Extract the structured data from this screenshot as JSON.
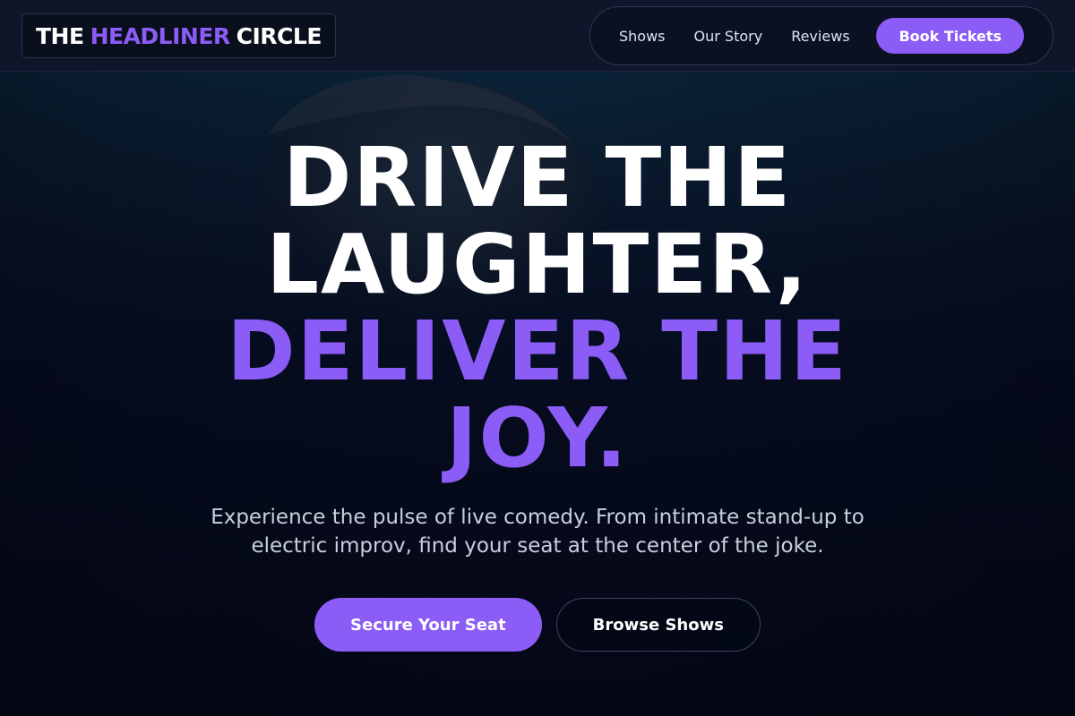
{
  "brand": {
    "logo_part1": "THE",
    "logo_part2": "HEADLINER",
    "logo_part3": "CIRCLE",
    "accent_color": "#8b5cf6"
  },
  "nav": {
    "items": [
      {
        "label": "Shows"
      },
      {
        "label": "Our Story"
      },
      {
        "label": "Reviews"
      }
    ],
    "cta_label": "Book Tickets"
  },
  "hero": {
    "headline_line1": "DRIVE THE",
    "headline_line2": "LAUGHTER,",
    "headline_line3": "DELIVER THE",
    "headline_line4": "JOY.",
    "subtitle": "Experience the pulse of live comedy. From intimate stand-up to electric improv, find your seat at the center of the joke.",
    "primary_cta": "Secure Your Seat",
    "secondary_cta": "Browse Shows"
  }
}
